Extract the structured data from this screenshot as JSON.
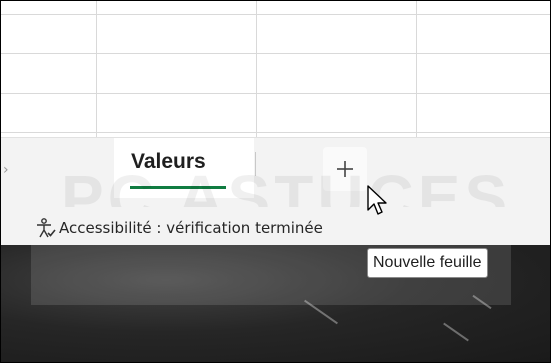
{
  "sheet_tabs": [
    {
      "label": "Valeurs",
      "active": true
    }
  ],
  "add_sheet_button": {
    "symbol": "+",
    "icon": "plus-icon"
  },
  "status_bar": {
    "accessibility_icon": "accessibility-icon",
    "accessibility_text": "Accessibilité : vérification terminée"
  },
  "tooltip": {
    "text": "Nouvelle feuille"
  },
  "colors": {
    "active_tab_underline": "#107c41",
    "tab_bar_background": "#f3f3f3"
  }
}
